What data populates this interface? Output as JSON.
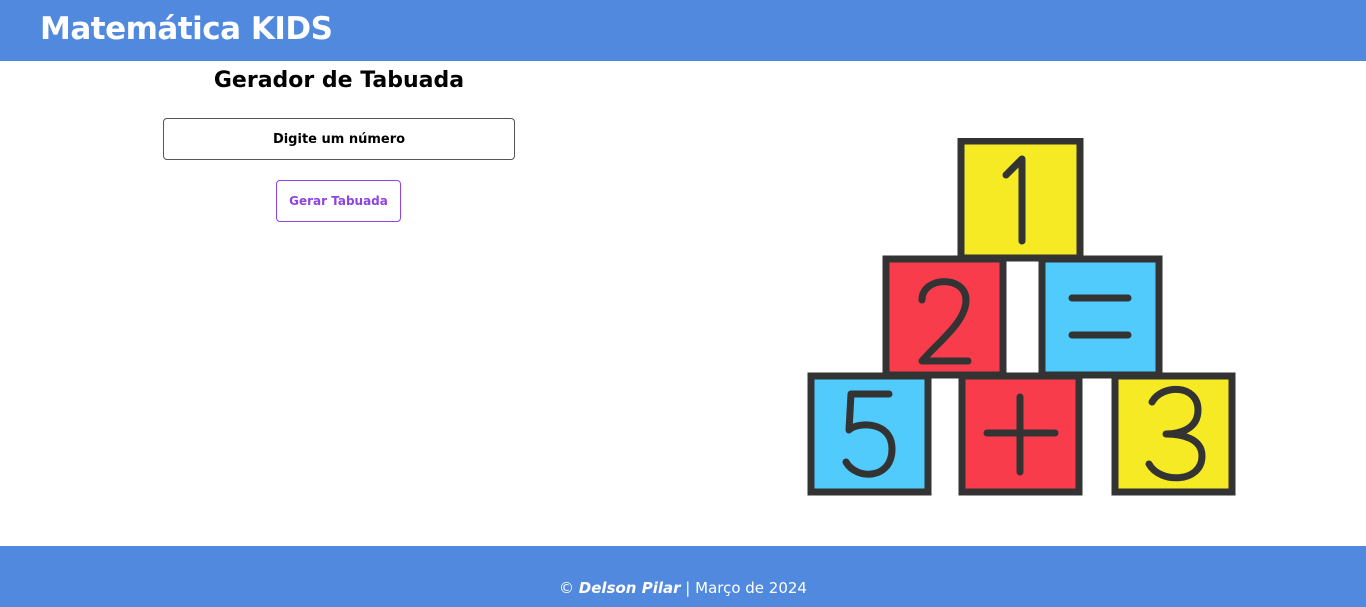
{
  "header": {
    "brand": "Matemática KIDS",
    "color": "#5089dd"
  },
  "main": {
    "title": "Gerador de Tabuada",
    "input": {
      "placeholder": "Digite um número",
      "value": ""
    },
    "button_label": "Gerar Tabuada",
    "button_color": "#8e44e0"
  },
  "illustration": {
    "name": "math-blocks-illustration",
    "blocks": [
      {
        "symbol": "1",
        "color": "#f5ea24"
      },
      {
        "symbol": "2",
        "color": "#f93c4b"
      },
      {
        "symbol": "=",
        "color": "#50cbfc"
      },
      {
        "symbol": "5",
        "color": "#50cbfc"
      },
      {
        "symbol": "+",
        "color": "#f93c4b"
      },
      {
        "symbol": "3",
        "color": "#f5ea24"
      }
    ]
  },
  "footer": {
    "copyright": "©",
    "author": "Delson Pilar",
    "separator": "|",
    "date": "Março de 2024"
  }
}
